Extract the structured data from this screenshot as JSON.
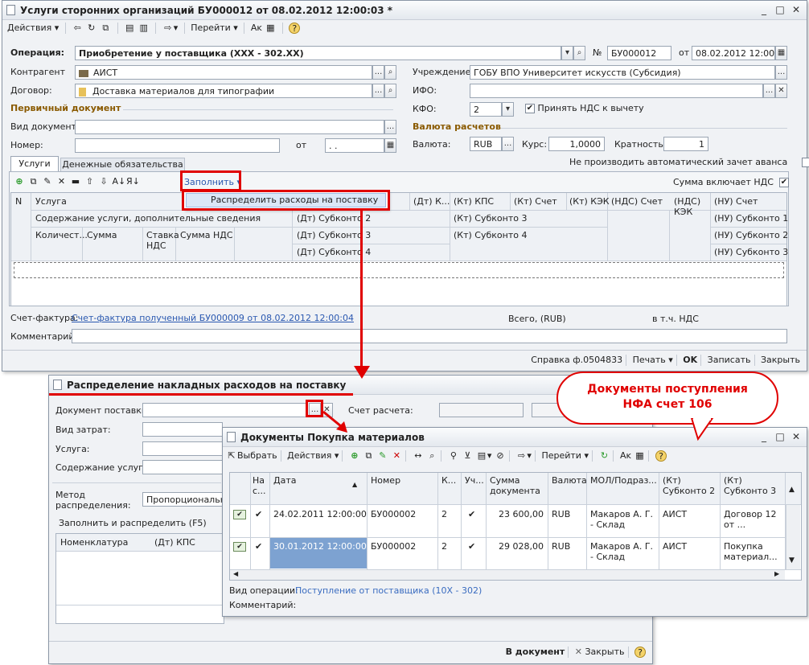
{
  "main": {
    "title": "Услуги сторонних организаций БУ000012 от 08.02.2012 12:00:03 *",
    "toolbar": {
      "actions": "Действия",
      "goto": "Перейти"
    },
    "operation_label": "Операция:",
    "operation_value": "Приобретение у поставщика (ХХХ - 302.ХХ)",
    "num_label": "№",
    "num_value": "БУ000012",
    "date_label": "от",
    "date_value": "08.02.2012 12:00:03",
    "contractor_label": "Контрагент",
    "contractor_value": "АИСТ",
    "contract_label": "Договор:",
    "contract_value": "Доставка материалов для типографии",
    "institution_label": "Учреждение:",
    "institution_value": "ГОБУ ВПО Университет искусств (Субсидия)",
    "ifo_label": "ИФО:",
    "ifo_value": "",
    "kfo_label": "КФО:",
    "kfo_value": "2",
    "vat_accept_label": "Принять НДС к вычету",
    "primary_doc_section": "Первичный документ",
    "doc_type_label": "Вид документа",
    "number_label": "Номер:",
    "from_label": "от",
    "from_value": ". .",
    "currency_section": "Валюта расчетов",
    "currency_label": "Валюта:",
    "currency_value": "RUB",
    "rate_label": "Курс:",
    "rate_value": "1,0000",
    "multiplicity_label": "Кратность:",
    "multiplicity_value": "1",
    "tabs": [
      "Услуги",
      "Денежные обязательства"
    ],
    "no_auto_advance_label": "Не производить автоматический зачет аванса",
    "fill_label": "Заполнить",
    "vat_included_label": "Сумма включает НДС",
    "dropdown_item": "Распределить расходы на поставку",
    "columns": {
      "n": "N",
      "service": "Услуга",
      "content": "Содержание услуги, дополнительные сведения",
      "qty": "Количест...",
      "sum": "Сумма",
      "vat_rate": "Ставка НДС",
      "vat_sum": "Сумма НДС",
      "dt_s2": "(Дт) Субконто 2",
      "dt_s3": "(Дт) Субконто 3",
      "dt_s4": "(Дт) Субконто 4",
      "dt_k": "(Дт) К...",
      "kt_kps": "(Кт) КПС",
      "kt_s3": "(Кт) Субконто 3",
      "kt_s4": "(Кт) Субконто 4",
      "kt_acc": "(Кт) Счет",
      "kt_kek": "(Кт) КЭК",
      "nds_acc": "(НДС) Счет",
      "nds_kek": "(НДС) КЭК",
      "nu_acc": "(НУ) Счет",
      "nu_s1": "(НУ) Субконто 1",
      "nu_s2": "(НУ) Субконто 2",
      "nu_s3": "(НУ) Субконто 3"
    },
    "invoice_label": "Счет-фактура:",
    "invoice_link": "Счет-фактура полученный БУ000009 от 08.02.2012 12:00:04",
    "total_label": "Всего, (RUB)",
    "incl_vat_label": "в т.ч. НДС",
    "comment_label": "Комментарий:",
    "bottom": {
      "print_form": "Справка ф.0504833",
      "print": "Печать",
      "ok": "OK",
      "save": "Записать",
      "close": "Закрыть"
    }
  },
  "dist": {
    "title": "Распределение накладных расходов на поставку",
    "supply_doc_label": "Документ поставки",
    "cost_type_label": "Вид затрат:",
    "service_label": "Услуга:",
    "content_label": "Содержание услуги:",
    "method_label": "Метод распределения:",
    "method_value": "Пропорционально",
    "account_label": "Счет расчета:",
    "fill_dist_label": "Заполнить и распределить (F5)",
    "col_nomenclature": "Номенклатура",
    "col_dt_kps": "(Дт) КПС",
    "bottom_doc": "В документ",
    "bottom_close": "Закрыть"
  },
  "callout": {
    "text_line1": "Документы поступления",
    "text_line2": "НФА счет 106"
  },
  "docs": {
    "title": "Документы Покупка материалов",
    "toolbar": {
      "select": "Выбрать",
      "actions": "Действия",
      "goto": "Перейти"
    },
    "columns": [
      "На с...",
      "Дата",
      "Номер",
      "К...",
      "Уч...",
      "Сумма документа",
      "Валюта",
      "МОЛ/Подраз...",
      "(Кт) Субконто 2",
      "(Кт) Субконто 3"
    ],
    "rows": [
      {
        "posted": "✔",
        "date": "24.02.2011 12:00:00",
        "number": "БУ000002",
        "k": "2",
        "uch": "✔",
        "sum": "23 600,00",
        "currency": "RUB",
        "mol": "Макаров А. Г. - Склад",
        "kt_s2": "АИСТ",
        "kt_s3": "Договор 12 от ..."
      },
      {
        "posted": "✔",
        "date": "30.01.2012 12:00:00",
        "number": "БУ000002",
        "k": "2",
        "uch": "✔",
        "sum": "29 028,00",
        "currency": "RUB",
        "mol": "Макаров А. Г. - Склад",
        "kt_s2": "АИСТ",
        "kt_s3": "Покупка материал..."
      }
    ],
    "op_type_label": "Вид операции:",
    "op_type_value": "Поступление от поставщика (10Х - 302)",
    "comment_label": "Комментарий:"
  }
}
